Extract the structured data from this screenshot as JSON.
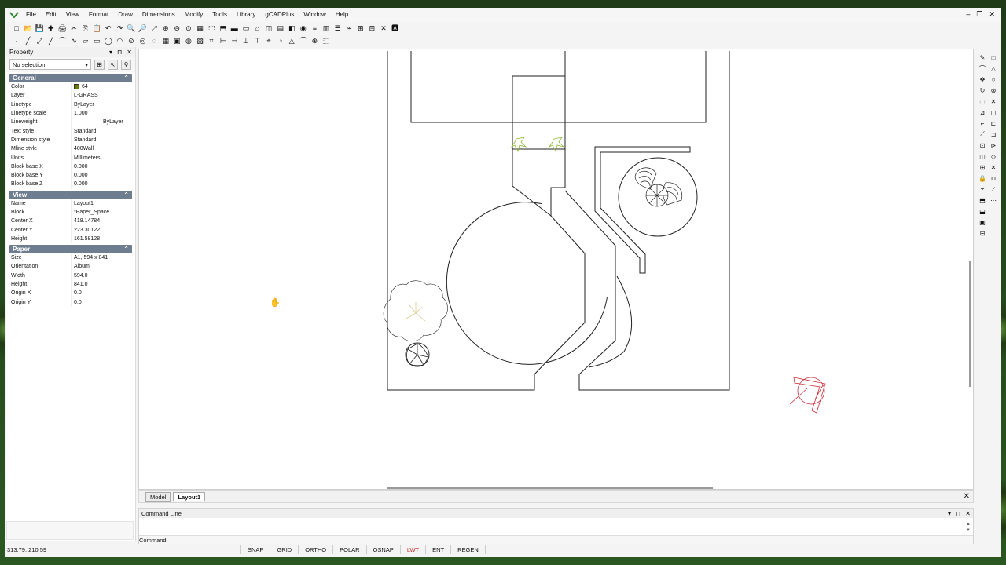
{
  "menu": {
    "items": [
      "File",
      "Edit",
      "View",
      "Format",
      "Draw",
      "Dimensions",
      "Modify",
      "Tools",
      "Library",
      "gCADPlus",
      "Window",
      "Help"
    ]
  },
  "window_controls": [
    "–",
    "❐",
    "✕"
  ],
  "toolbar_row1": [
    "□",
    "📂",
    "💾",
    "✚",
    "🖨",
    "✂",
    "⎘",
    "📋",
    "↶",
    "↷",
    "🔍",
    "🔎",
    "⤢",
    "⊕",
    "⊖",
    "⊙",
    "▦",
    "⬚",
    "⬒",
    "▬",
    "▭",
    "⌂",
    "◫",
    "▤",
    "◧",
    "◉",
    "≡",
    "▥",
    "☰",
    "⌁",
    "⊞",
    "⊟",
    "✕",
    "🅰"
  ],
  "toolbar_row2": [
    "·",
    "╱",
    "⤢",
    "╱",
    "⌒",
    "∿",
    "▱",
    "▭",
    "◯",
    "◠",
    "⊙",
    "◎",
    "◌",
    "▦",
    "▣",
    "◍",
    "▧",
    "⌗",
    "⊢",
    "⊣",
    "⊥",
    "⊤",
    "⌖",
    "◔",
    "△",
    "⌒",
    "⊕",
    "⬚"
  ],
  "property_panel": {
    "title": "Property",
    "title_controls": [
      "▾",
      "⊓",
      "✕"
    ],
    "selection": "No selection",
    "sections": [
      {
        "name": "General",
        "rows": [
          {
            "key": "Color",
            "value": "64"
          },
          {
            "key": "Layer",
            "value": "L-GRASS"
          },
          {
            "key": "Linetype",
            "value": "ByLayer"
          },
          {
            "key": "Linetype scale",
            "value": "1.000"
          },
          {
            "key": "Lineweight",
            "value": "ByLayer"
          },
          {
            "key": "Text style",
            "value": "Standard"
          },
          {
            "key": "Dimension style",
            "value": "Standard"
          },
          {
            "key": "Mline style",
            "value": "400Wall"
          },
          {
            "key": "Units",
            "value": "Millimeters"
          },
          {
            "key": "Block base X",
            "value": "0.000"
          },
          {
            "key": "Block base Y",
            "value": "0.000"
          },
          {
            "key": "Block base Z",
            "value": "0.000"
          }
        ]
      },
      {
        "name": "View",
        "rows": [
          {
            "key": "Name",
            "value": "Layout1"
          },
          {
            "key": "Block",
            "value": "*Paper_Space"
          },
          {
            "key": "Center X",
            "value": "418.14784"
          },
          {
            "key": "Center Y",
            "value": "223.30122"
          },
          {
            "key": "Height",
            "value": "161.58128"
          }
        ]
      },
      {
        "name": "Paper",
        "rows": [
          {
            "key": "Size",
            "value": "A1,  594 x 841"
          },
          {
            "key": "Orientation",
            "value": "Album"
          },
          {
            "key": "Width",
            "value": "594.0"
          },
          {
            "key": "Height",
            "value": "841.0"
          },
          {
            "key": "Origin X",
            "value": "0.0"
          },
          {
            "key": "Origin Y",
            "value": "0.0"
          }
        ]
      }
    ]
  },
  "tabs": {
    "model": "Model",
    "layout": "Layout1"
  },
  "command_line": {
    "title": "Command Line",
    "prompt": "Command:"
  },
  "status_bar": {
    "coords": "313.79,  210.59",
    "toggles": [
      "SNAP",
      "GRID",
      "ORTHO",
      "POLAR",
      "OSNAP",
      "LWT",
      "ENT",
      "REGEN"
    ],
    "active": "LWT"
  },
  "colors": {
    "accent_section": "#6e7d8f",
    "color_swatch": "#6b7a00",
    "status_on": "#d03030",
    "plant_green": "#8fb83a",
    "marker_red": "#d0303a"
  },
  "right_toolbar": {
    "col1": [
      "✎",
      "⌒",
      "✥",
      "↻",
      "⬚",
      "⊿",
      "⌐",
      "⟋",
      "⊡",
      "◫",
      "⊞",
      "🔒",
      "⌖",
      "⬒",
      "⬓",
      "▣",
      "⊟"
    ],
    "col2": [
      "□",
      "△",
      "○",
      "⊗",
      "✕",
      "◻",
      "⊏",
      "⊐",
      "⊳",
      "◇",
      "✕",
      "⊓",
      "∕",
      "⋯"
    ]
  }
}
